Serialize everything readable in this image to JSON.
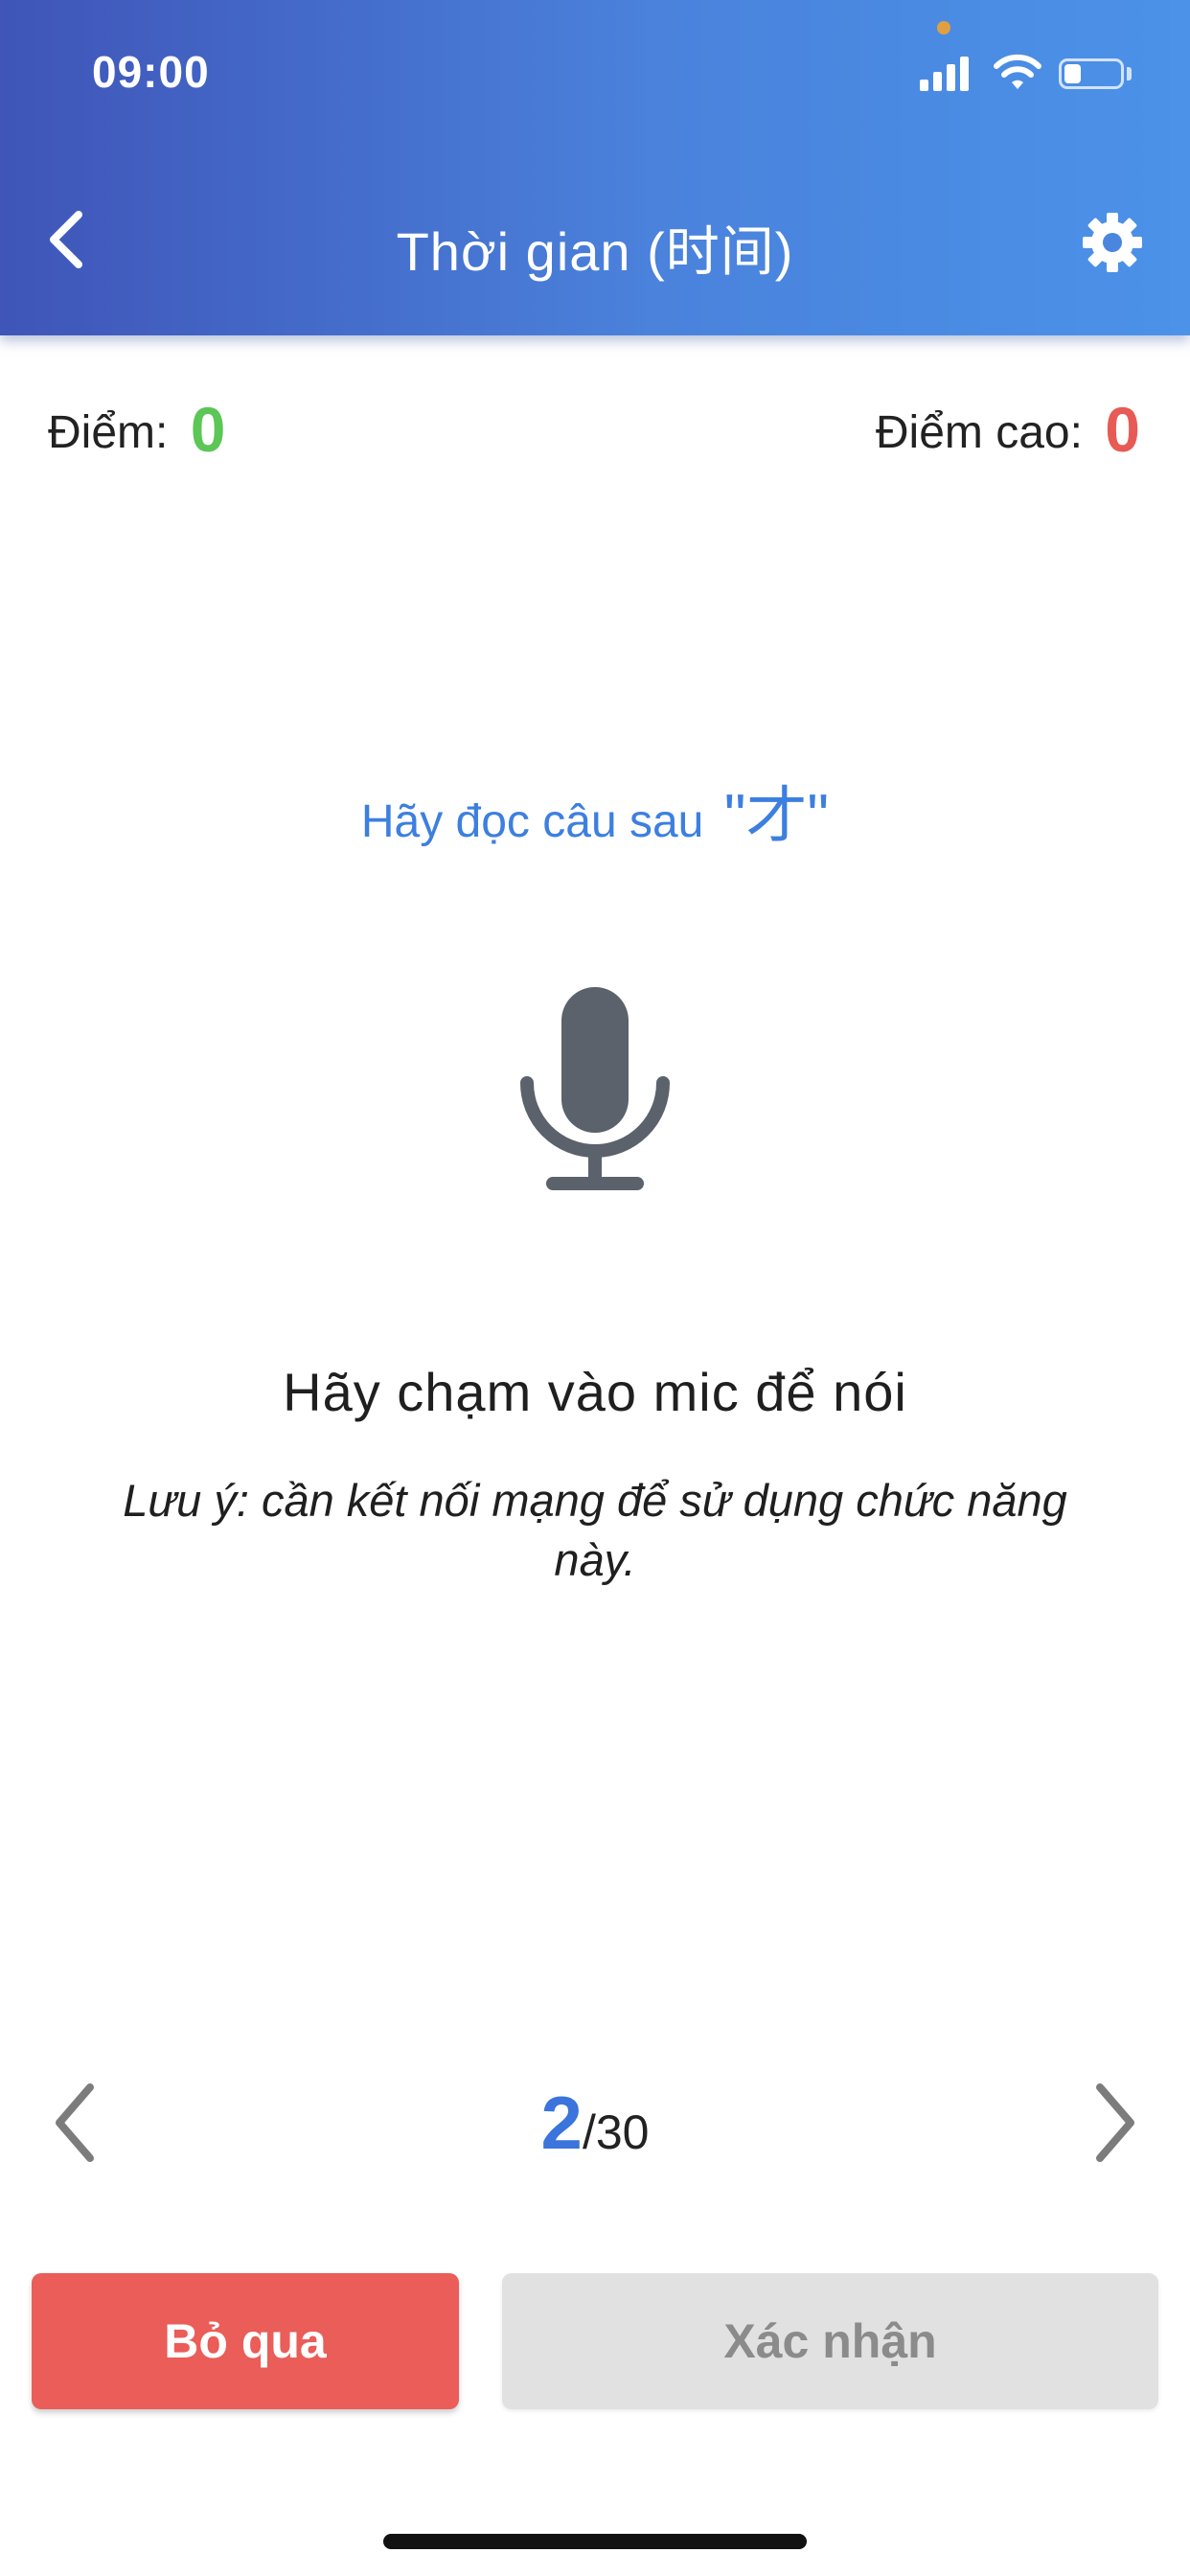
{
  "status_bar": {
    "time": "09:00",
    "battery_level": 0.3,
    "icons": [
      "signal-icon",
      "wifi-icon",
      "battery-icon"
    ]
  },
  "header": {
    "title": "Thời gian (时间)",
    "back_icon": "chevron-left-icon",
    "settings_icon": "gear-icon"
  },
  "score": {
    "label": "Điểm:",
    "value": "0",
    "high_label": "Điểm cao:",
    "high_value": "0"
  },
  "prompt": {
    "text": "Hãy đọc câu sau",
    "target": "\"才\""
  },
  "mic": {
    "icon": "microphone-icon",
    "hint": "Hãy chạm vào mic để nói",
    "note": "Lưu ý: cần kết nối mạng để sử dụng chức năng này."
  },
  "pager": {
    "current": "2",
    "total": "/30",
    "prev_icon": "chevron-left-icon",
    "next_icon": "chevron-right-icon"
  },
  "actions": {
    "skip_label": "Bỏ qua",
    "confirm_label": "Xác nhận"
  },
  "colors": {
    "header_gradient_start": "#3f55b8",
    "header_gradient_end": "#4b92e8",
    "score_green": "#5cc657",
    "score_red": "#e85a55",
    "accent_blue": "#3d7fe0",
    "skip_button": "#ea5d58",
    "confirm_button_disabled": "#e1e1e1"
  }
}
